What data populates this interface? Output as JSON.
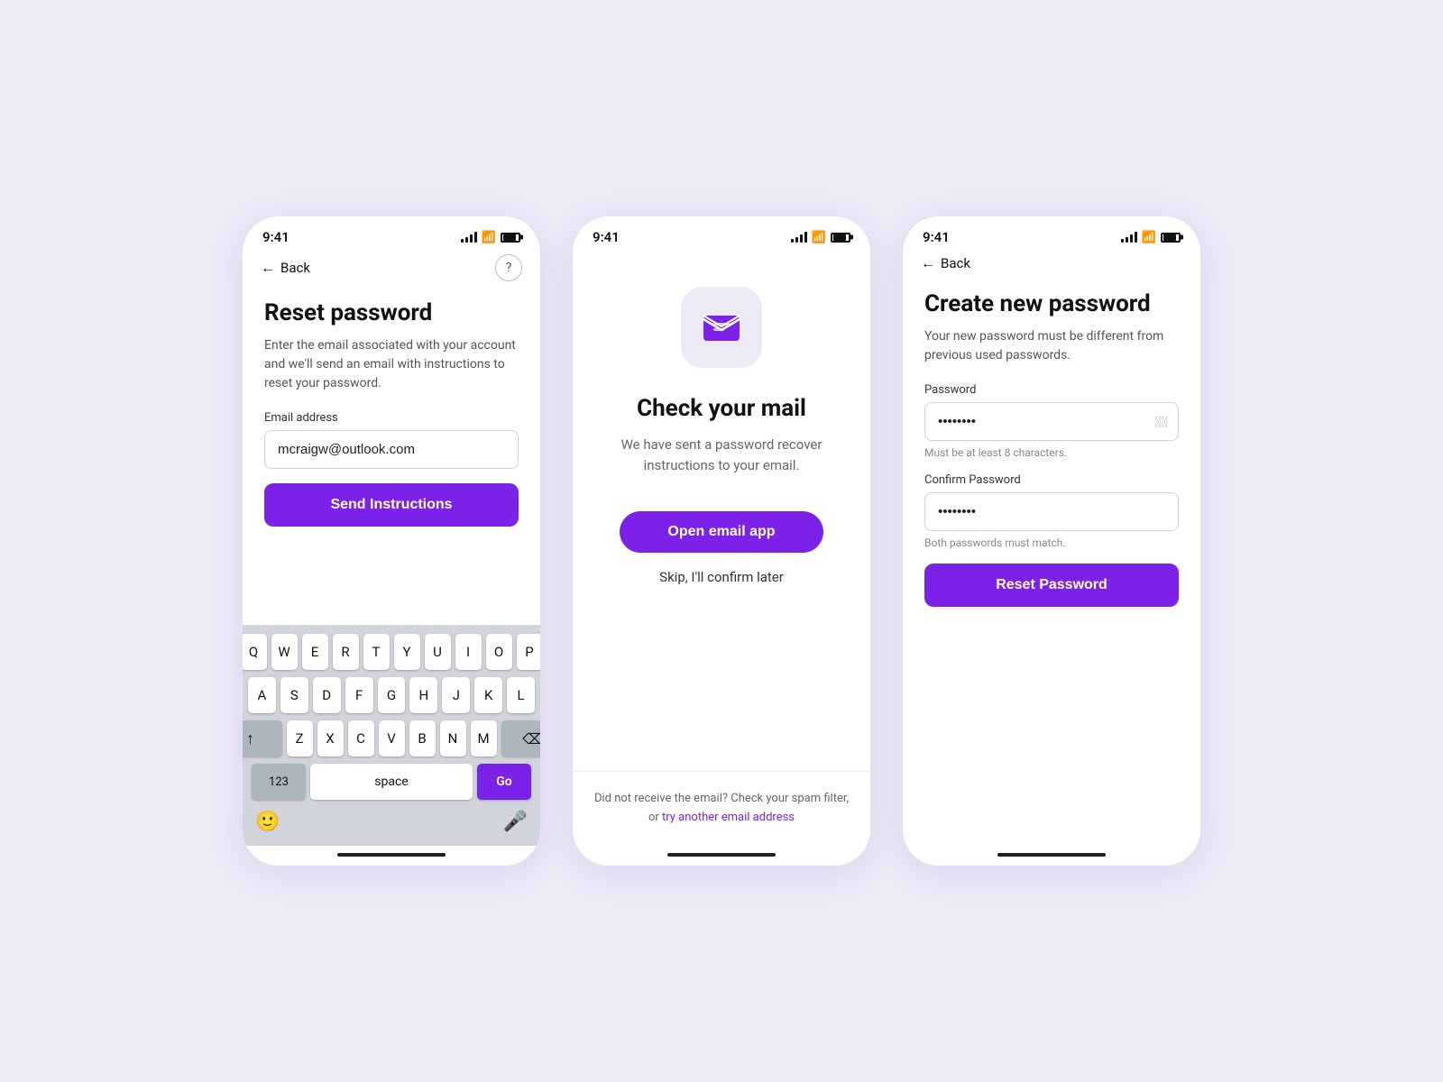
{
  "background_color": "#ede9f7",
  "accent_color": "#7c22e8",
  "phones": [
    {
      "id": "phone1",
      "status_time": "9:41",
      "nav": {
        "back_label": "Back",
        "help_label": "?"
      },
      "title": "Reset password",
      "subtitle": "Enter the email associated with your account and we'll send an email with instructions to reset your password.",
      "email_label": "Email address",
      "email_placeholder": "mcraigw@outlook.com",
      "email_value": "mcraigw@outlook.com",
      "send_button": "Send Instructions",
      "keyboard": {
        "row1": [
          "Q",
          "W",
          "E",
          "R",
          "T",
          "Y",
          "U",
          "I",
          "O",
          "P"
        ],
        "row2": [
          "A",
          "S",
          "D",
          "F",
          "G",
          "H",
          "J",
          "K",
          "L"
        ],
        "row3": [
          "Z",
          "X",
          "C",
          "V",
          "B",
          "N",
          "M"
        ],
        "num_label": "123",
        "space_label": "space",
        "go_label": "Go"
      }
    },
    {
      "id": "phone2",
      "status_time": "9:41",
      "check_title": "Check your mail",
      "check_subtitle": "We have sent a password recover instructions to your email.",
      "open_email_button": "Open email app",
      "skip_label": "Skip, I'll confirm later",
      "footer_text": "Did not receive the email? Check your spam filter,",
      "footer_link_prefix": "or ",
      "footer_link": "try another email address"
    },
    {
      "id": "phone3",
      "status_time": "9:41",
      "nav": {
        "back_label": "Back"
      },
      "title": "Create new password",
      "subtitle": "Your new password must be different from previous used passwords.",
      "password_label": "Password",
      "password_value": "••••••••",
      "password_hint": "Must be at least 8 characters.",
      "confirm_label": "Confirm Password",
      "confirm_value": "••••••••",
      "confirm_hint": "Both passwords must match.",
      "reset_button": "Reset Password"
    }
  ]
}
